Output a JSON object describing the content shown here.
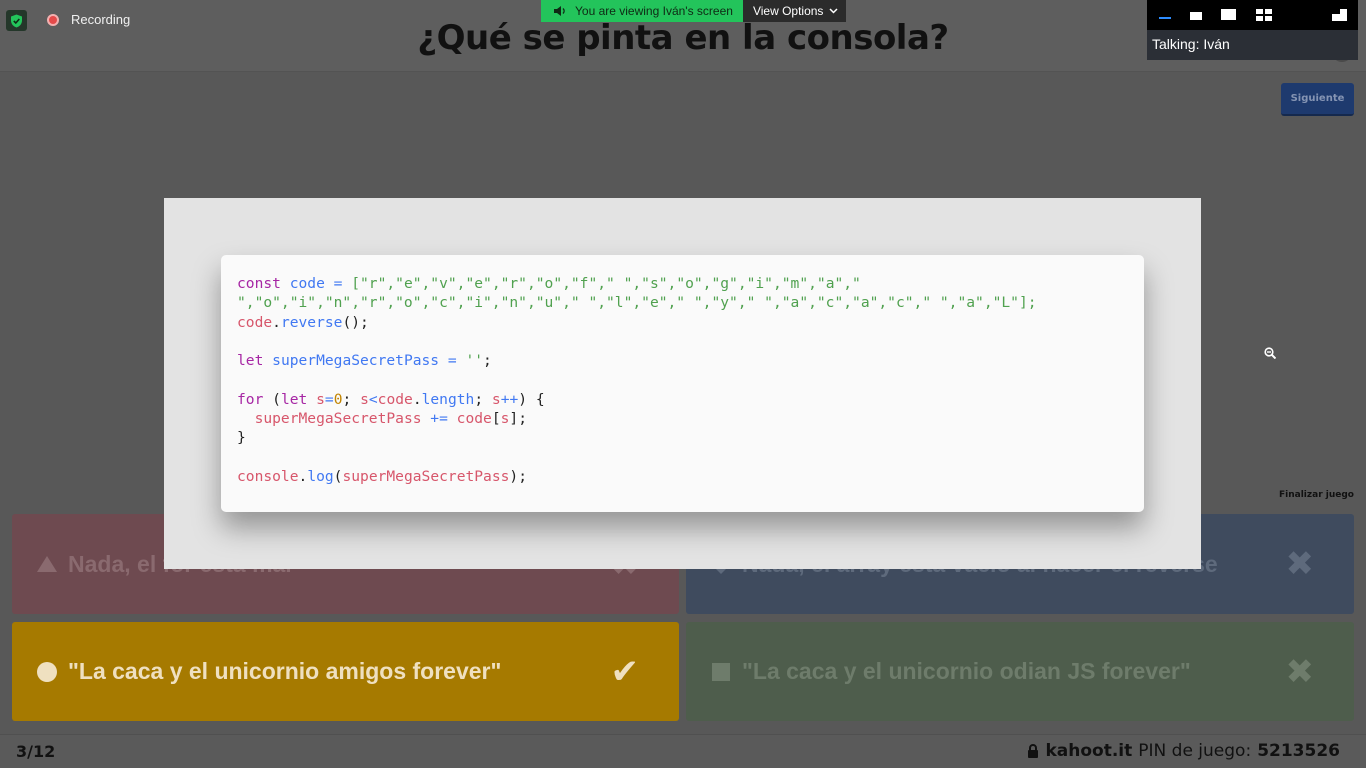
{
  "zoom": {
    "recording_label": "Recording",
    "share_banner": "You are viewing Iván's screen",
    "view_options_label": "View Options",
    "talking": "Talking: Iván"
  },
  "kahoot": {
    "question": "¿Qué se pinta en la consola?",
    "next_button": "Siguiente",
    "end_game": "Finalizar juego",
    "counter": "3/12",
    "site": "kahoot.it",
    "pin_label": "PIN de juego:",
    "pin": "5213526",
    "answers": [
      {
        "text": "Nada, el for está mal",
        "shape": "triangle",
        "correct": false,
        "color": "#6e4a50"
      },
      {
        "text": "Nada, el array está vacío al hacer el reverse",
        "shape": "diamond",
        "correct": false,
        "color": "#3f4b5e"
      },
      {
        "text": "\"La caca y el unicornio amigos forever\"",
        "shape": "circle",
        "correct": true,
        "color": "#a67a00"
      },
      {
        "text": "\"La caca y el unicornio odian JS forever\"",
        "shape": "square",
        "correct": false,
        "color": "#4e5d4c"
      }
    ]
  },
  "code": {
    "line1_prefix": "const ",
    "line1_var": "code",
    "line1_eq": " = ",
    "line1_arr": "[\"r\",\"e\",\"v\",\"e\",\"r\",\"o\",\"f\",\" \",\"s\",\"o\",\"g\",\"i\",\"m\",\"a\",\"",
    "line2": "\",\"o\",\"i\",\"n\",\"r\",\"o\",\"c\",\"i\",\"n\",\"u\",\" \",\"l\",\"e\",\" \",\"y\",\" \",\"a\",\"c\",\"a\",\"c\",\" \",\"a\",\"L\"];",
    "line3_obj": "code",
    "line3_dot": ".",
    "line3_fn": "reverse",
    "line3_end": "();",
    "line4_kw": "let",
    "line4_var": "superMegaSecretPass",
    "line4_eq": " = ",
    "line4_str": "''",
    "line4_end": ";",
    "line5_kw": "for",
    "line5_paren": " (",
    "line5_let": "let",
    "line5_s": "s",
    "line5_eq": "=",
    "line5_zero": "0",
    "line5_semi": "; ",
    "line5_s2": "s",
    "line5_lt": "<",
    "line5_code": "code",
    "line5_dot": ".",
    "line5_len": "length",
    "line5_semi2": "; ",
    "line5_s3": "s",
    "line5_inc": "++",
    "line5_close": ") {",
    "line6_var": "superMegaSecretPass",
    "line6_op": " += ",
    "line6_code": "code",
    "line6_br1": "[",
    "line6_s": "s",
    "line6_br2": "];",
    "line7": "}",
    "line8_obj": "console",
    "line8_dot": ".",
    "line8_fn": "log",
    "line8_p1": "(",
    "line8_arg": "superMegaSecretPass",
    "line8_p2": ");"
  },
  "colors": {
    "zoom_green": "#23c45b",
    "kahoot_next": "#1e3a6e",
    "correct_answer": "#a67a00"
  }
}
